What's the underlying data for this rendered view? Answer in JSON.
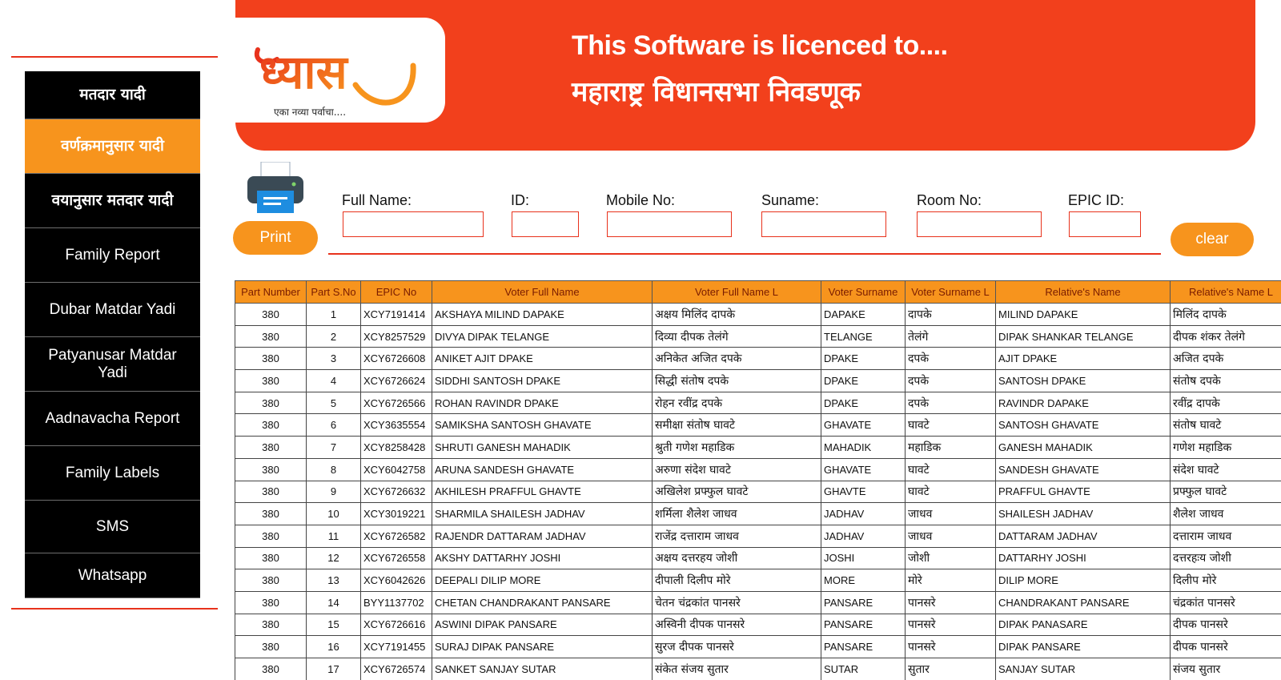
{
  "sidebar": {
    "items": [
      {
        "label": "मतदार यादी",
        "mr": true,
        "active": false,
        "name": "sidebar-item-matdar-yadi"
      },
      {
        "label": "वर्णक्रमानुसार यादी",
        "mr": true,
        "active": true,
        "name": "sidebar-item-varnakramanusar-yadi"
      },
      {
        "label": "वयानुसार मतदार यादी",
        "mr": true,
        "active": false,
        "name": "sidebar-item-vayanusar-matdar-yadi"
      },
      {
        "label": "Family Report",
        "mr": false,
        "active": false,
        "name": "sidebar-item-family-report"
      },
      {
        "label": "Dubar Matdar Yadi",
        "mr": false,
        "active": false,
        "name": "sidebar-item-dubar-matdar-yadi"
      },
      {
        "label": "Patyanusar Matdar Yadi",
        "mr": false,
        "active": false,
        "name": "sidebar-item-patyanusar-matdar-yadi"
      },
      {
        "label": "Aadnavacha Report",
        "mr": false,
        "active": false,
        "name": "sidebar-item-aadnavacha-report"
      },
      {
        "label": "Family Labels",
        "mr": false,
        "active": false,
        "name": "sidebar-item-family-labels"
      },
      {
        "label": "SMS",
        "mr": false,
        "active": false,
        "name": "sidebar-item-sms"
      },
      {
        "label": "Whatsapp",
        "mr": false,
        "active": false,
        "name": "sidebar-item-whatsapp"
      }
    ]
  },
  "header": {
    "logo_text": "ध्यास",
    "logo_tagline": "एका नव्या पर्वाचा....",
    "license_line": "This Software is licenced to....",
    "licensee": "महाराष्ट्र विधानसभा निवडणूक"
  },
  "toolbar": {
    "print_label": "Print",
    "clear_label": "clear"
  },
  "search": {
    "full_name_label": "Full Name:",
    "full_name_value": "",
    "id_label": "ID:",
    "id_value": "",
    "mobile_label": "Mobile No:",
    "mobile_value": "",
    "surname_label": "Suname:",
    "surname_value": "",
    "room_label": "Room No:",
    "room_value": "",
    "epic_label": "EPIC ID:",
    "epic_value": ""
  },
  "table": {
    "columns": [
      "Part Number",
      "Part S.No",
      "EPIC No",
      "Voter Full Name",
      "Voter Full Name L",
      "Voter Surname",
      "Voter Surname L",
      "Relative's Name",
      "Relative's Name L"
    ],
    "rows": [
      [
        "380",
        "1",
        "XCY7191414",
        "AKSHAYA MILIND DAPAKE",
        "अक्षय मिलिंद दापके",
        "DAPAKE",
        "दापके",
        "MILIND DAPAKE",
        "मिलिंद दापके"
      ],
      [
        "380",
        "2",
        "XCY8257529",
        "DIVYA DIPAK TELANGE",
        "दिव्या दीपक तेलंगे",
        "TELANGE",
        "तेलंगे",
        "DIPAK SHANKAR TELANGE",
        "दीपक शंकर तेलंगे"
      ],
      [
        "380",
        "3",
        "XCY6726608",
        "ANIKET AJIT DPAKE",
        "अनिकेत अजित दपके",
        "DPAKE",
        "दपके",
        "AJIT DPAKE",
        "अजित दपके"
      ],
      [
        "380",
        "4",
        "XCY6726624",
        "SIDDHI SANTOSH DPAKE",
        "सिद्धी संतोष दपके",
        "DPAKE",
        "दपके",
        "SANTOSH DPAKE",
        "संतोष दपके"
      ],
      [
        "380",
        "5",
        "XCY6726566",
        "ROHAN RAVINDR DPAKE",
        "रोहन रवींद्र दपके",
        "DPAKE",
        "दपके",
        "RAVINDR DAPAKE",
        "रवींद्र दापके"
      ],
      [
        "380",
        "6",
        "XCY3635554",
        "SAMIKSHA SANTOSH GHAVATE",
        "समीक्षा संतोष घावटे",
        "GHAVATE",
        "घावटे",
        "SANTOSH GHAVATE",
        "संतोष घावटे"
      ],
      [
        "380",
        "7",
        "XCY8258428",
        "SHRUTI GANESH MAHADIK",
        "श्रुती गणेश महाडिक",
        "MAHADIK",
        "महाडिक",
        "GANESH MAHADIK",
        "गणेश महाडिक"
      ],
      [
        "380",
        "8",
        "XCY6042758",
        "ARUNA SANDESH GHAVATE",
        "अरुणा संदेश घावटे",
        "GHAVATE",
        "घावटे",
        "SANDESH GHAVATE",
        "संदेश घावटे"
      ],
      [
        "380",
        "9",
        "XCY6726632",
        "AKHILESH PRAFFUL GHAVTE",
        "अखिलेश प्रफ्फुल घावटे",
        "GHAVTE",
        "घावटे",
        "PRAFFUL GHAVTE",
        "प्रफ्फुल घावटे"
      ],
      [
        "380",
        "10",
        "XCY3019221",
        "SHARMILA SHAILESH JADHAV",
        "शर्मिला शैलेश जाधव",
        "JADHAV",
        "जाधव",
        "SHAILESH JADHAV",
        "शैलेश जाधव"
      ],
      [
        "380",
        "11",
        "XCY6726582",
        "RAJENDR DATTARAM JADHAV",
        "राजेंद्र दत्ताराम जाधव",
        "JADHAV",
        "जाधव",
        "DATTARAM JADHAV",
        "दत्ताराम जाधव"
      ],
      [
        "380",
        "12",
        "XCY6726558",
        "AKSHY DATTARHY JOSHI",
        "अक्षय दत्तरहय जोशी",
        "JOSHI",
        "जोशी",
        "DATTARHY JOSHI",
        "दत्तरहःय जोशी"
      ],
      [
        "380",
        "13",
        "XCY6042626",
        "DEEPALI DILIP MORE",
        "दीपाली दिलीप मोरे",
        "MORE",
        "मोरे",
        "DILIP MORE",
        "दिलीप मोरे"
      ],
      [
        "380",
        "14",
        "BYY1137702",
        "CHETAN CHANDRAKANT PANSARE",
        "चेतन चंद्रकांत पानसरे",
        "PANSARE",
        "पानसरे",
        "CHANDRAKANT PANSARE",
        "चंद्रकांत पानसरे"
      ],
      [
        "380",
        "15",
        "XCY6726616",
        "ASWINI DIPAK PANSARE",
        "अस्विनी दीपक पानसरे",
        "PANSARE",
        "पानसरे",
        "DIPAK PANASARE",
        "दीपक पानसरे"
      ],
      [
        "380",
        "16",
        "XCY7191455",
        "SURAJ DIPAK PANSARE",
        "सुरज दीपक पानसरे",
        "PANSARE",
        "पानसरे",
        "DIPAK PANSARE",
        "दीपक पानसरे"
      ],
      [
        "380",
        "17",
        "XCY6726574",
        "SANKET SANJAY SUTAR",
        "संकेत संजय सुतार",
        "SUTAR",
        "सुतार",
        "SANJAY SUTAR",
        "संजय सुतार"
      ]
    ]
  },
  "colors": {
    "brand_red": "#f2401c",
    "accent_orange": "#f7941d",
    "sidebar_bg": "#000000"
  }
}
